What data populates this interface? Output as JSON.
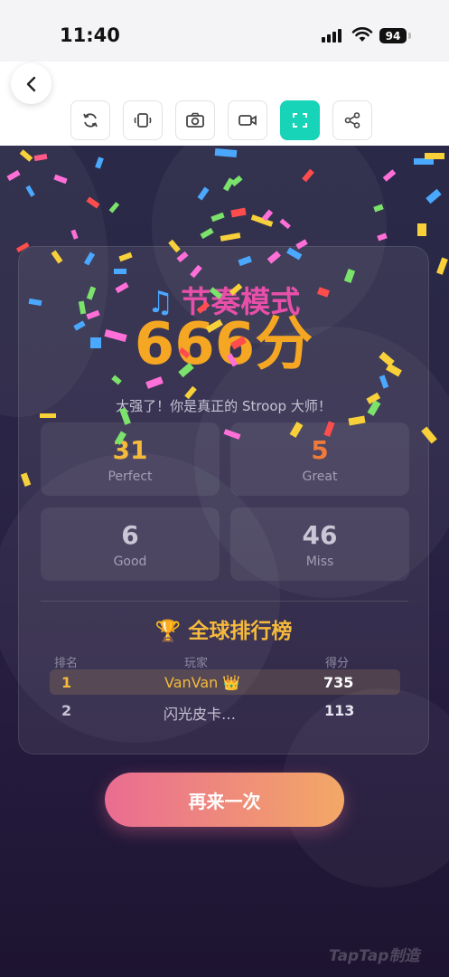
{
  "status": {
    "time": "11:40",
    "battery": "94"
  },
  "toolbar": {
    "icons": [
      "back-icon",
      "refresh-icon",
      "rotate-icon",
      "camera-icon",
      "video-icon",
      "fullscreen-icon",
      "share-icon"
    ],
    "active_color": "#17d3b8"
  },
  "result": {
    "mode_title": "节奏模式",
    "score": "666分",
    "praise": "大强了！你是真正的 Stroop 大师！",
    "stats": [
      {
        "value": "31",
        "label": "Perfect",
        "color": "#f5b93c"
      },
      {
        "value": "5",
        "label": "Great",
        "color": "#f07a3a"
      },
      {
        "value": "6",
        "label": "Good",
        "color": "#c9c6d6"
      },
      {
        "value": "46",
        "label": "Miss",
        "color": "#c9c6d6"
      }
    ]
  },
  "leaderboard": {
    "title": "全球排行榜",
    "headers": {
      "rank": "排名",
      "player": "玩家",
      "score": "得分"
    },
    "rows": [
      {
        "rank": "1",
        "player": "VanVan",
        "score": "735"
      },
      {
        "rank": "2",
        "player": "闪光皮卡…",
        "score": "113"
      }
    ]
  },
  "actions": {
    "again": "再来一次"
  },
  "watermark": "TapTap制造",
  "colors": {
    "accent_pink": "#e84fa9",
    "accent_gold": "#f5a623",
    "button_start": "#ea6c92",
    "button_end": "#f3a866"
  }
}
